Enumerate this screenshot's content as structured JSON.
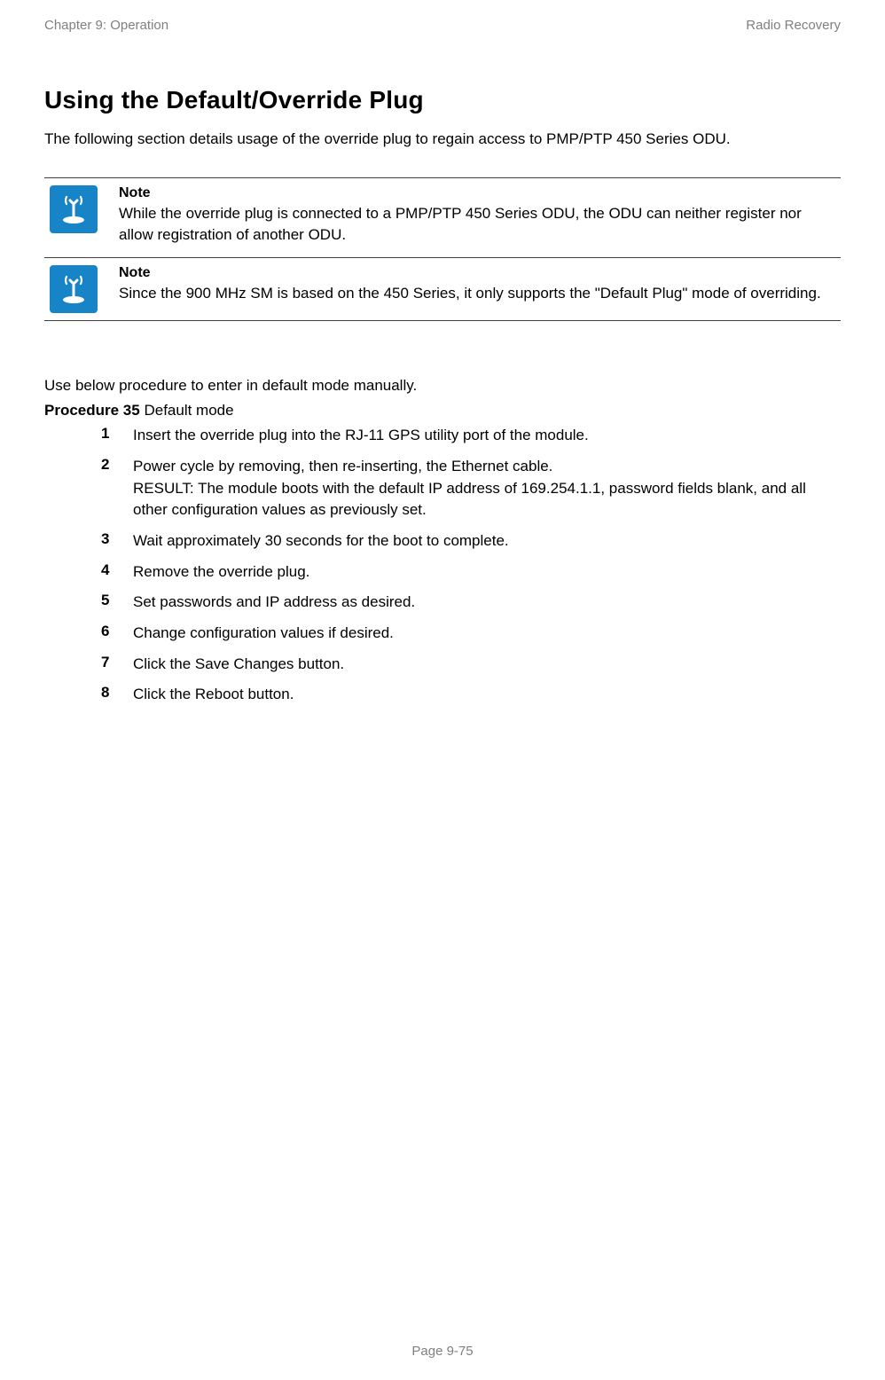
{
  "header": {
    "left": "Chapter 9:  Operation",
    "right": "Radio Recovery"
  },
  "heading": "Using the Default/Override Plug",
  "intro": "The following section details usage of the override plug to regain access to PMP/PTP 450 Series ODU.",
  "notes": [
    {
      "label": "Note",
      "text": "While the override plug is connected to a PMP/PTP 450 Series ODU, the ODU can neither register nor allow registration of another ODU."
    },
    {
      "label": "Note",
      "text": "Since the 900 MHz SM is based on the 450 Series, it only supports the \"Default Plug\" mode of overriding."
    }
  ],
  "subtext": "Use below procedure to enter in default mode manually.",
  "procedure": {
    "label": "Procedure 35",
    "title": " Default mode"
  },
  "steps": [
    {
      "n": "1",
      "text": "Insert the override plug into the RJ-11 GPS utility port of the module."
    },
    {
      "n": "2",
      "text": "Power cycle by removing, then re-inserting, the Ethernet cable.\nRESULT: The module boots with the default IP address of 169.254.1.1, password fields blank, and all other configuration values as previously set."
    },
    {
      "n": "3",
      "text": "Wait approximately 30 seconds for the boot to complete."
    },
    {
      "n": "4",
      "text": "Remove the override plug."
    },
    {
      "n": "5",
      "text": "Set passwords and IP address as desired."
    },
    {
      "n": "6",
      "text": "Change configuration values if desired."
    },
    {
      "n": "7",
      "text": "Click the Save Changes button."
    },
    {
      "n": "8",
      "text": "Click the Reboot button."
    }
  ],
  "footer": "Page 9-75"
}
